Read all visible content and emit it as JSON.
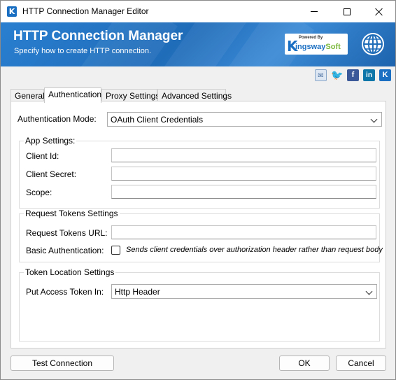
{
  "window": {
    "title": "HTTP Connection Manager Editor"
  },
  "banner": {
    "title": "HTTP Connection Manager",
    "subtitle": "Specify how to create HTTP connection.",
    "brand_powered": "Powered By",
    "brand_k": "K",
    "brand_name_blue": "ingsway",
    "brand_name_green": "Soft"
  },
  "social": {
    "icons": [
      "mail-icon",
      "twitter-icon",
      "facebook-icon",
      "linkedin-icon",
      "kingswaysoft-icon"
    ]
  },
  "tabs": [
    {
      "label": "General"
    },
    {
      "label": "Authentication"
    },
    {
      "label": "Proxy Settings"
    },
    {
      "label": "Advanced Settings"
    }
  ],
  "active_tab": "Authentication",
  "auth": {
    "mode_label": "Authentication Mode:",
    "mode_value": "OAuth Client Credentials"
  },
  "app_settings": {
    "title": "App Settings:",
    "client_id_label": "Client Id:",
    "client_id_value": "",
    "client_secret_label": "Client Secret:",
    "client_secret_value": "",
    "scope_label": "Scope:",
    "scope_value": ""
  },
  "request_tokens": {
    "title": "Request Tokens Settings",
    "url_label": "Request Tokens URL:",
    "url_value": "",
    "basic_auth_label": "Basic Authentication:",
    "basic_auth_checked": false,
    "basic_auth_note": "Sends client credentials over authorization header rather than request body"
  },
  "token_location": {
    "title": "Token Location Settings",
    "put_label": "Put Access Token In:",
    "put_value": "Http Header"
  },
  "buttons": {
    "test": "Test Connection",
    "ok": "OK",
    "cancel": "Cancel"
  },
  "colors": {
    "banner_blue": "#1f6cb9",
    "brand_blue": "#1b6fc2",
    "brand_green": "#7ab83c"
  }
}
